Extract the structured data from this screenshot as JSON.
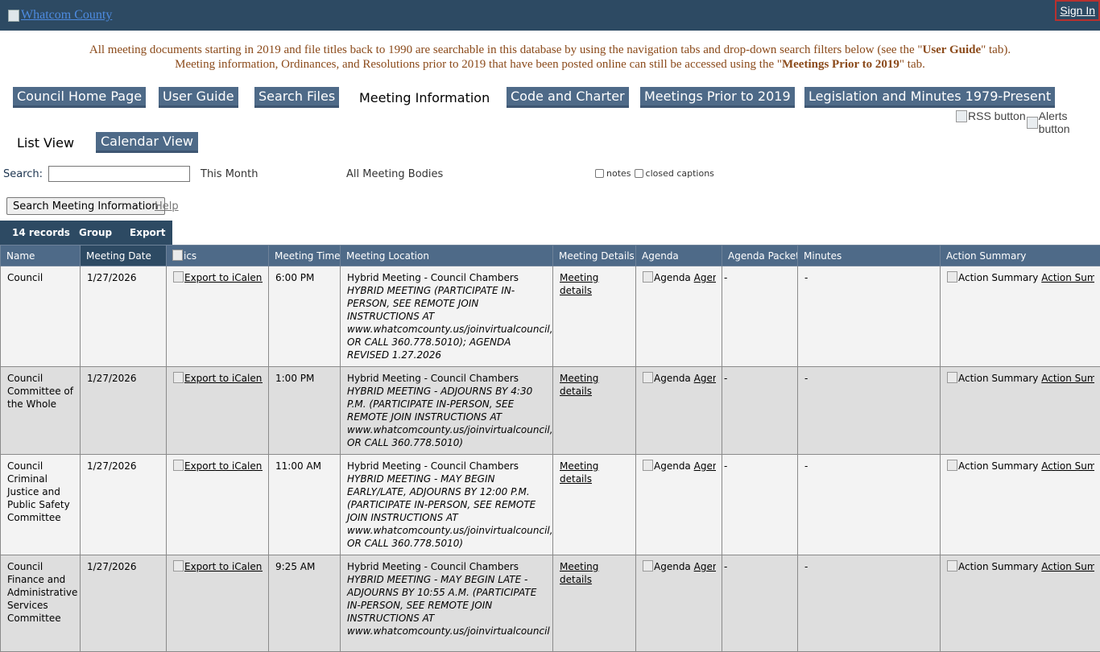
{
  "header": {
    "logo_alt": "Whatcom County",
    "sign_in": "Sign In"
  },
  "notice": {
    "line1_a": "All meeting documents starting in 2019 and file titles back to 1990 are searchable in this database by using the navigation tabs and drop-down search filters below (see the \"",
    "line1_b": "User Guide",
    "line1_c": "\" tab).",
    "line2_a": "Meeting information, Ordinances, and Resolutions prior to 2019 that have been posted online can still be accessed using the \"",
    "line2_b": "Meetings Prior to 2019",
    "line2_c": "\" tab."
  },
  "tabs": [
    {
      "label": "Council Home Page"
    },
    {
      "label": "User Guide"
    },
    {
      "label": "Search Files"
    },
    {
      "label": "Meeting Information"
    },
    {
      "label": "Code and Charter"
    },
    {
      "label": "Meetings Prior to 2019"
    },
    {
      "label": "Legislation and Minutes 1979-Present"
    }
  ],
  "feeds": {
    "rss": "RSS button",
    "alerts": "Alerts button"
  },
  "views": {
    "list": "List View",
    "calendar": "Calendar View"
  },
  "search": {
    "label": "Search:",
    "value": "",
    "period": "This Month",
    "bodies": "All Meeting Bodies",
    "notes_label": "notes",
    "captions_label": "closed captions",
    "button": "Search Meeting Information",
    "help": "Help"
  },
  "gridbar": {
    "records": "14 records",
    "group": "Group",
    "export": "Export"
  },
  "columns": {
    "name": "Name",
    "date": "Meeting Date",
    "ics": "ics",
    "time": "Meeting Time",
    "location": "Meeting Location",
    "details": "Meeting Details",
    "agenda": "Agenda",
    "packet": "Agenda Packet",
    "minutes": "Minutes",
    "summary": "Action Summary"
  },
  "rows": [
    {
      "name": "Council",
      "date": "1/27/2026",
      "ics": "Export to iCalendar",
      "time": "6:00 PM",
      "loc_title": "Hybrid Meeting - Council Chambers",
      "loc_desc": "HYBRID MEETING (PARTICIPATE IN-PERSON, SEE REMOTE JOIN INSTRUCTIONS AT www.whatcomcounty.us/joinvirtualcouncil, OR CALL 360.778.5010); AGENDA REVISED 1.27.2026",
      "details": "Meeting details",
      "agenda_img": "Agenda",
      "agenda_link": "Agenda",
      "packet": "-",
      "minutes": "-",
      "summary_img": "Action Summary",
      "summary_link": "Action Summary"
    },
    {
      "name": "Council Committee of the Whole",
      "date": "1/27/2026",
      "ics": "Export to iCalendar",
      "time": "1:00 PM",
      "loc_title": "Hybrid Meeting - Council Chambers",
      "loc_desc": "HYBRID MEETING - ADJOURNS BY 4:30 P.M. (PARTICIPATE IN-PERSON, SEE REMOTE JOIN INSTRUCTIONS AT www.whatcomcounty.us/joinvirtualcouncil, OR CALL 360.778.5010)",
      "details": "Meeting details",
      "agenda_img": "Agenda",
      "agenda_link": "Agenda",
      "packet": "-",
      "minutes": "-",
      "summary_img": "Action Summary",
      "summary_link": "Action Summary"
    },
    {
      "name": "Council Criminal Justice and Public Safety Committee",
      "date": "1/27/2026",
      "ics": "Export to iCalendar",
      "time": "11:00 AM",
      "loc_title": "Hybrid Meeting - Council Chambers",
      "loc_desc": "HYBRID MEETING - MAY BEGIN EARLY/LATE, ADJOURNS BY 12:00 P.M. (PARTICIPATE IN-PERSON, SEE REMOTE JOIN INSTRUCTIONS AT www.whatcomcounty.us/joinvirtualcouncil, OR CALL 360.778.5010)",
      "details": "Meeting details",
      "agenda_img": "Agenda",
      "agenda_link": "Agenda",
      "packet": "-",
      "minutes": "-",
      "summary_img": "Action Summary",
      "summary_link": "Action Summary"
    },
    {
      "name": "Council Finance and Administrative Services Committee",
      "date": "1/27/2026",
      "ics": "Export to iCalendar",
      "time": "9:25 AM",
      "loc_title": "Hybrid Meeting - Council Chambers",
      "loc_desc": "HYBRID MEETING - MAY BEGIN LATE - ADJOURNS BY 10:55 A.M. (PARTICIPATE IN-PERSON, SEE REMOTE JOIN INSTRUCTIONS AT www.whatcomcounty.us/joinvirtualcouncil",
      "details": "Meeting details",
      "agenda_img": "Agenda",
      "agenda_link": "Agenda",
      "packet": "-",
      "minutes": "-",
      "summary_img": "Action Summary",
      "summary_link": "Action Summary"
    }
  ]
}
